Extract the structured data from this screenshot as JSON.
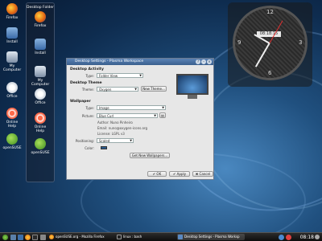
{
  "desktop": {
    "icons_left": [
      {
        "label": "Firefox",
        "icon": "firefox-icon"
      },
      {
        "label": "Install",
        "icon": "install-icon"
      },
      {
        "label": "My Computer",
        "icon": "computer-icon"
      },
      {
        "label": "Office",
        "icon": "office-icon"
      },
      {
        "label": "Online Help",
        "icon": "help-icon"
      },
      {
        "label": "openSUSE",
        "icon": "opensuse-icon"
      }
    ],
    "folder": {
      "title": "Desktop Folder",
      "icons": [
        {
          "label": "Firefox",
          "icon": "firefox-icon"
        },
        {
          "label": "Install",
          "icon": "install-icon"
        },
        {
          "label": "My Computer",
          "icon": "computer-icon"
        },
        {
          "label": "Office",
          "icon": "office-icon"
        },
        {
          "label": "Online Help",
          "icon": "help-icon"
        },
        {
          "label": "openSUSE",
          "icon": "opensuse-icon"
        }
      ]
    }
  },
  "clock": {
    "time": "08:18:15",
    "numbers": [
      "12",
      "3",
      "6",
      "9"
    ]
  },
  "dialog": {
    "title": "Desktop Settings - Plasma Workspace",
    "activity_section": "Desktop Activity",
    "type_label": "Type:",
    "activity_type": "Folder View",
    "theme_section": "Desktop Theme",
    "theme_label": "Theme:",
    "theme_value": "Oxygen",
    "new_theme_button": "New Theme...",
    "wallpaper_section": "Wallpaper",
    "wallpaper_type_label": "Type:",
    "wallpaper_type": "Image",
    "picture_label": "Picture:",
    "picture_value": "Blue Curl",
    "author": "Author: Nuno Pinheiro",
    "email": "Email: nuno@oxygen-icons.org",
    "license": "License: LGPL v3",
    "positioning_label": "Positioning:",
    "positioning_value": "Scaled",
    "color_label": "Color:",
    "get_wallpapers_button": "Get New Wallpapers...",
    "ok_button": "OK",
    "apply_button": "Apply",
    "cancel_button": "Cancel"
  },
  "taskbar": {
    "tasks": [
      {
        "label": "openSUSE.org - Mozilla Firefox",
        "active": false
      },
      {
        "label": "linux : bash",
        "active": false
      },
      {
        "label": "Desktop Settings - Plasma Worksp",
        "active": true
      }
    ],
    "clock": "08:18"
  },
  "colors": {
    "accent": "#3a5f8e",
    "wallpaper_color": "#2a5a8e"
  }
}
